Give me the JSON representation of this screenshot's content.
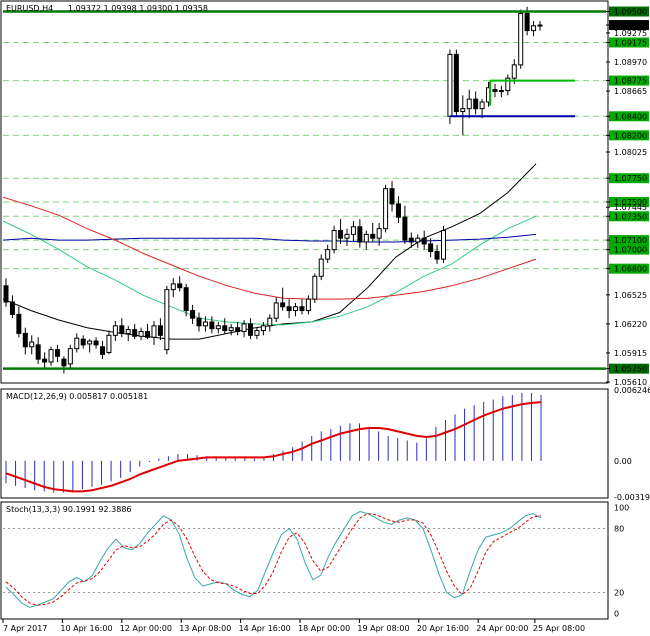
{
  "chart_data": {
    "type": "candlestick",
    "symbol_header": "EURUSD,H4",
    "ohlc_header": "1.09372 1.09398 1.09300 1.09358",
    "current_price": "1.09358",
    "price_axis": {
      "range": [
        1.0561,
        1.096
      ],
      "tick_labels": [
        "1.09500",
        "1.09358",
        "1.09275",
        "1.09175",
        "1.08970",
        "1.08775",
        "1.08665",
        "1.08400",
        "1.08200",
        "1.08025",
        "1.07750",
        "1.07500",
        "1.07445",
        "1.07350",
        "1.07100",
        "1.07000",
        "1.06800",
        "1.06525",
        "1.06220",
        "1.05915",
        "1.05750",
        "1.05610"
      ],
      "tick_values": [
        1.095,
        1.09358,
        1.09275,
        1.09175,
        1.0897,
        1.08775,
        1.08665,
        1.084,
        1.082,
        1.08025,
        1.0775,
        1.075,
        1.07445,
        1.0735,
        1.071,
        1.07,
        1.068,
        1.06525,
        1.0622,
        1.05915,
        1.0575,
        1.0561
      ],
      "highlighted": [
        "1.09500",
        "1.09175",
        "1.08775",
        "1.08400",
        "1.08200",
        "1.07750",
        "1.07500",
        "1.07350",
        "1.07100",
        "1.07000",
        "1.06800",
        "1.05750"
      ]
    },
    "levels": [
      {
        "value": 1.095,
        "color": "#007a00",
        "style": "thick"
      },
      {
        "value": 1.0575,
        "color": "#007a00",
        "style": "thick"
      },
      {
        "value": 1.08775,
        "color": "#00bb00",
        "style": "segment"
      },
      {
        "value": 1.084,
        "color": "#0000aa",
        "style": "segment"
      }
    ],
    "candles": [
      [
        1.0662,
        1.067,
        1.064,
        1.0645
      ],
      [
        1.0645,
        1.0652,
        1.0628,
        1.0632
      ],
      [
        1.0632,
        1.064,
        1.0608,
        1.0612
      ],
      [
        1.0612,
        1.0618,
        1.059,
        1.0598
      ],
      [
        1.0598,
        1.061,
        1.059,
        1.0603
      ],
      [
        1.06,
        1.0608,
        1.058,
        1.0585
      ],
      [
        1.0585,
        1.0592,
        1.0576,
        1.0582
      ],
      [
        1.0582,
        1.0598,
        1.0578,
        1.0595
      ],
      [
        1.0595,
        1.06,
        1.0582,
        1.0588
      ],
      [
        1.0585,
        1.0588,
        1.057,
        1.0578
      ],
      [
        1.058,
        1.06,
        1.0576,
        1.0596
      ],
      [
        1.0596,
        1.0612,
        1.0592,
        1.0607
      ],
      [
        1.0606,
        1.061,
        1.0596,
        1.06
      ],
      [
        1.0601,
        1.0606,
        1.0592,
        1.0604
      ],
      [
        1.0604,
        1.0608,
        1.0596,
        1.06
      ],
      [
        1.0598,
        1.0604,
        1.0585,
        1.059
      ],
      [
        1.0592,
        1.0615,
        1.059,
        1.061
      ],
      [
        1.061,
        1.0625,
        1.0604,
        1.062
      ],
      [
        1.062,
        1.0628,
        1.0608,
        1.0612
      ],
      [
        1.0612,
        1.062,
        1.0604,
        1.0616
      ],
      [
        1.0616,
        1.0622,
        1.0606,
        1.0609
      ],
      [
        1.0609,
        1.0618,
        1.0605,
        1.0614
      ],
      [
        1.0614,
        1.0622,
        1.0606,
        1.0608
      ],
      [
        1.0608,
        1.0625,
        1.06,
        1.062
      ],
      [
        1.062,
        1.0628,
        1.0605,
        1.061
      ],
      [
        1.0595,
        1.0662,
        1.059,
        1.0658
      ],
      [
        1.0658,
        1.067,
        1.065,
        1.0664
      ],
      [
        1.0664,
        1.0672,
        1.0656,
        1.066
      ],
      [
        1.066,
        1.0664,
        1.063,
        1.0636
      ],
      [
        1.0636,
        1.0642,
        1.0622,
        1.0628
      ],
      [
        1.0628,
        1.0634,
        1.0614,
        1.062
      ],
      [
        1.062,
        1.063,
        1.0614,
        1.0624
      ],
      [
        1.0624,
        1.063,
        1.0612,
        1.0617
      ],
      [
        1.0617,
        1.0624,
        1.0612,
        1.062
      ],
      [
        1.062,
        1.0628,
        1.0612,
        1.0615
      ],
      [
        1.0615,
        1.0622,
        1.061,
        1.0618
      ],
      [
        1.0618,
        1.0624,
        1.061,
        1.0614
      ],
      [
        1.0614,
        1.0626,
        1.0608,
        1.0622
      ],
      [
        1.0622,
        1.0628,
        1.0606,
        1.061
      ],
      [
        1.061,
        1.0618,
        1.0606,
        1.0615
      ],
      [
        1.0615,
        1.0624,
        1.061,
        1.062
      ],
      [
        1.062,
        1.0632,
        1.0614,
        1.0628
      ],
      [
        1.0628,
        1.065,
        1.0624,
        1.0644
      ],
      [
        1.0644,
        1.066,
        1.0636,
        1.064
      ],
      [
        1.064,
        1.0648,
        1.0628,
        1.0636
      ],
      [
        1.0636,
        1.0644,
        1.063,
        1.064
      ],
      [
        1.064,
        1.0648,
        1.0632,
        1.0636
      ],
      [
        1.0636,
        1.0652,
        1.0632,
        1.0648
      ],
      [
        1.0648,
        1.0675,
        1.0644,
        1.0672
      ],
      [
        1.0672,
        1.0695,
        1.0668,
        1.069
      ],
      [
        1.069,
        1.0705,
        1.0686,
        1.07
      ],
      [
        1.07,
        1.0725,
        1.0696,
        1.072
      ],
      [
        1.072,
        1.0732,
        1.0706,
        1.0712
      ],
      [
        1.0712,
        1.0722,
        1.0704,
        1.0716
      ],
      [
        1.0716,
        1.073,
        1.0708,
        1.0724
      ],
      [
        1.0724,
        1.0732,
        1.0702,
        1.0708
      ],
      [
        1.0708,
        1.072,
        1.07,
        1.0716
      ],
      [
        1.0716,
        1.0728,
        1.0708,
        1.0712
      ],
      [
        1.0712,
        1.0728,
        1.0704,
        1.0722
      ],
      [
        1.0722,
        1.0768,
        1.0718,
        1.0764
      ],
      [
        1.0764,
        1.0772,
        1.074,
        1.0748
      ],
      [
        1.0748,
        1.0756,
        1.0728,
        1.0734
      ],
      [
        1.0734,
        1.0746,
        1.0706,
        1.071
      ],
      [
        1.0712,
        1.0718,
        1.0702,
        1.0708
      ],
      [
        1.0708,
        1.0716,
        1.0702,
        1.0712
      ],
      [
        1.0712,
        1.072,
        1.07,
        1.0706
      ],
      [
        1.0706,
        1.0712,
        1.0692,
        1.0698
      ],
      [
        1.0698,
        1.0705,
        1.0685,
        1.069
      ],
      [
        1.069,
        1.0725,
        1.0686,
        1.072
      ],
      [
        1.084,
        1.091,
        1.0832,
        1.0905
      ],
      [
        1.0905,
        1.091,
        1.084,
        1.0845
      ],
      [
        1.0845,
        1.0862,
        1.082,
        1.0848
      ],
      [
        1.0848,
        1.0868,
        1.0838,
        1.0858
      ],
      [
        1.0858,
        1.0866,
        1.0842,
        1.0848
      ],
      [
        1.0848,
        1.0858,
        1.0838,
        1.0855
      ],
      [
        1.0855,
        1.0876,
        1.085,
        1.087
      ],
      [
        1.0868,
        1.0874,
        1.086,
        1.0866
      ],
      [
        1.0866,
        1.0872,
        1.086,
        1.0867
      ],
      [
        1.0867,
        1.0884,
        1.0862,
        1.088
      ],
      [
        1.088,
        1.09,
        1.0874,
        1.0894
      ],
      [
        1.0894,
        1.0952,
        1.089,
        1.0948
      ],
      [
        1.0948,
        1.0955,
        1.0925,
        1.093
      ],
      [
        1.093,
        1.094,
        1.0924,
        1.0935
      ],
      [
        1.0935,
        1.094,
        1.093,
        1.09358
      ]
    ],
    "moving_averages": [
      {
        "color": "#000000",
        "values": [
          1.0648,
          1.0636,
          1.0626,
          1.0618,
          1.0613,
          1.0609,
          1.0606,
          1.0606,
          1.0612,
          1.0618,
          1.0622,
          1.0624,
          1.0634,
          1.066,
          1.0692,
          1.0712,
          1.0724,
          1.0738,
          1.076,
          1.079
        ]
      },
      {
        "color": "#2ecc80",
        "values": [
          1.073,
          1.0716,
          1.07,
          1.0682,
          1.0668,
          1.0652,
          1.064,
          1.0628,
          1.0624,
          1.0622,
          1.0621,
          1.0624,
          1.063,
          1.064,
          1.0655,
          1.0672,
          1.0685,
          1.0705,
          1.0722,
          1.0735
        ]
      },
      {
        "color": "#0000aa",
        "values": [
          1.071,
          1.0712,
          1.071,
          1.071,
          1.0711,
          1.0712,
          1.0712,
          1.0712,
          1.0712,
          1.0712,
          1.071,
          1.0709,
          1.0709,
          1.0708,
          1.0708,
          1.0709,
          1.071,
          1.0711,
          1.0713,
          1.0716
        ]
      },
      {
        "color": "#dd2222",
        "values": [
          1.0755,
          1.0746,
          1.0736,
          1.0722,
          1.071,
          1.0696,
          1.0684,
          1.0672,
          1.0662,
          1.0654,
          1.0649,
          1.0648,
          1.0648,
          1.0649,
          1.0652,
          1.0656,
          1.0662,
          1.067,
          1.068,
          1.069
        ]
      }
    ],
    "macd": {
      "label": "MACD(12,26,9) 0.005817 0.005181",
      "range": [
        -0.00319,
        0.00625
      ],
      "tick_labels": [
        "0.006246",
        "0.00",
        "-0.003195"
      ],
      "tick_values": [
        0.006246,
        0.0,
        -0.003195
      ],
      "histogram": [
        -0.002,
        -0.0022,
        -0.0024,
        -0.0026,
        -0.0027,
        -0.0028,
        -0.0028,
        -0.0027,
        -0.0025,
        -0.0023,
        -0.0021,
        -0.0018,
        -0.0015,
        -0.001,
        -0.0005,
        -0.0001,
        0.0002,
        0.0004,
        0.0006,
        0.0006,
        0.0005,
        0.0004,
        0.0004,
        0.0003,
        0.0003,
        0.0003,
        0.0002,
        0.0004,
        0.0006,
        0.0009,
        0.0012,
        0.0017,
        0.0022,
        0.0026,
        0.0028,
        0.0031,
        0.0033,
        0.0033,
        0.003,
        0.0026,
        0.0022,
        0.002,
        0.0018,
        0.0016,
        0.002,
        0.003,
        0.0036,
        0.0041,
        0.0046,
        0.0049,
        0.0052,
        0.0054,
        0.0057,
        0.0058,
        0.006,
        0.006,
        0.00582
      ],
      "signal": [
        -0.0011,
        -0.0014,
        -0.0017,
        -0.002,
        -0.0023,
        -0.0025,
        -0.0026,
        -0.0027,
        -0.0027,
        -0.0026,
        -0.0024,
        -0.0022,
        -0.0019,
        -0.0016,
        -0.0012,
        -0.0009,
        -0.0006,
        -0.0003,
        0.0,
        0.0001,
        0.0002,
        0.0003,
        0.0003,
        0.0003,
        0.0003,
        0.0003,
        0.0003,
        0.0003,
        0.0004,
        0.0006,
        0.0008,
        0.0011,
        0.0015,
        0.0018,
        0.0021,
        0.0024,
        0.0026,
        0.0028,
        0.0029,
        0.0029,
        0.0028,
        0.0026,
        0.0024,
        0.0022,
        0.0021,
        0.0022,
        0.0025,
        0.0028,
        0.0032,
        0.0036,
        0.004,
        0.0043,
        0.0046,
        0.0048,
        0.005,
        0.0051,
        0.00518
      ]
    },
    "stoch": {
      "label": "Stoch(13,3,3) 90.1991 92.3886",
      "tick_labels": [
        "100",
        "80",
        "20",
        "0"
      ],
      "tick_values": [
        100,
        80,
        20,
        0
      ],
      "main": [
        25,
        18,
        10,
        6,
        8,
        11,
        14,
        22,
        30,
        34,
        30,
        36,
        50,
        62,
        70,
        62,
        60,
        66,
        76,
        84,
        92,
        88,
        75,
        52,
        34,
        26,
        28,
        30,
        28,
        22,
        18,
        16,
        22,
        40,
        58,
        74,
        80,
        70,
        48,
        32,
        36,
        54,
        68,
        80,
        92,
        96,
        94,
        90,
        86,
        84,
        88,
        90,
        88,
        80,
        60,
        38,
        20,
        15,
        18,
        40,
        60,
        72,
        74,
        76,
        80,
        86,
        92,
        94,
        90
      ],
      "signal": [
        30,
        24,
        16,
        10,
        8,
        9,
        11,
        16,
        23,
        29,
        31,
        33,
        40,
        50,
        60,
        64,
        62,
        63,
        68,
        75,
        84,
        88,
        82,
        70,
        54,
        40,
        32,
        29,
        28,
        26,
        22,
        19,
        19,
        27,
        40,
        58,
        72,
        76,
        66,
        50,
        40,
        44,
        56,
        68,
        80,
        90,
        94,
        93,
        90,
        87,
        86,
        88,
        88,
        85,
        74,
        58,
        40,
        26,
        18,
        24,
        40,
        58,
        68,
        72,
        76,
        80,
        86,
        91,
        92
      ]
    },
    "x_axis_labels": [
      "7 Apr 2017",
      "10 Apr 16:00",
      "12 Apr 00:00",
      "13 Apr 08:00",
      "14 Apr 16:00",
      "18 Apr 00:00",
      "19 Apr 08:00",
      "20 Apr 16:00",
      "24 Apr 00:00",
      "25 Apr 08:00"
    ],
    "x_axis_fractions": [
      0.0,
      0.11,
      0.22,
      0.33,
      0.44,
      0.55,
      0.66,
      0.77,
      0.88,
      0.985
    ]
  }
}
